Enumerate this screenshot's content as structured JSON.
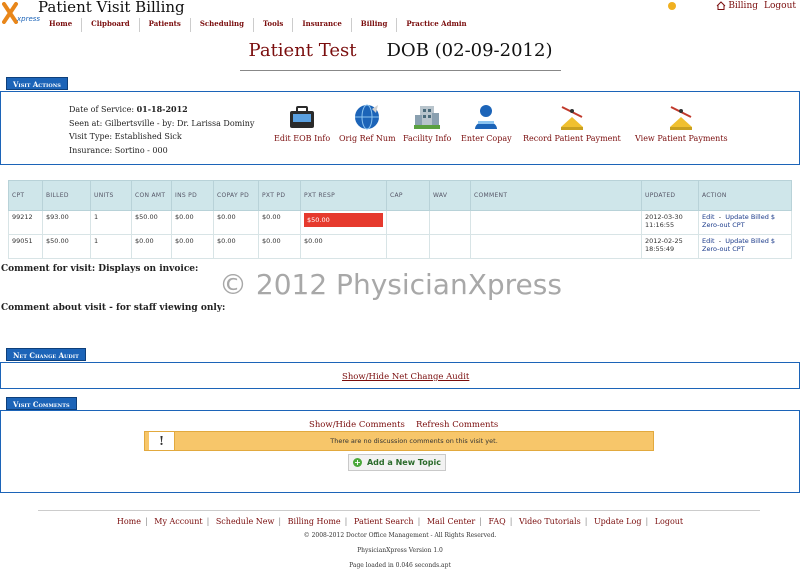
{
  "app": {
    "title": "Patient Visit Billing",
    "logo_text": "xpress"
  },
  "main_nav": [
    "Home",
    "Clipboard",
    "Patients",
    "Scheduling",
    "Tools",
    "Insurance",
    "Billing",
    "Practice Admin"
  ],
  "top_right": {
    "billing_label": "Billing",
    "logout_label": "Logout"
  },
  "patient": {
    "name": "Patient Test",
    "dob": "DOB (02-09-2012)"
  },
  "visit_actions": {
    "section_title": "Visit Actions",
    "info": {
      "date_of_service_label": "Date of Service:",
      "date_of_service": "01-18-2012",
      "seen_at": "Seen at: Gilbertsville - by: Dr. Larissa Dominy",
      "visit_type": "Visit Type: Established Sick",
      "insurance": "Insurance: Sortino - 000"
    },
    "actions": [
      {
        "label": "Edit EOB Info",
        "icon": "briefcase-icon"
      },
      {
        "label": "Orig Ref Num",
        "icon": "globe-icon"
      },
      {
        "label": "Facility Info",
        "icon": "building-icon"
      },
      {
        "label": "Enter Copay",
        "icon": "person-icon"
      },
      {
        "label": "Record Patient Payment",
        "icon": "scale-icon"
      },
      {
        "label": "View Patient Payments",
        "icon": "scale-icon"
      }
    ]
  },
  "charges_table": {
    "columns": [
      "CPT",
      "BILLED",
      "UNITS",
      "CON AMT",
      "INS PD",
      "COPAY PD",
      "PXT PD",
      "PXT RESP",
      "CAP",
      "WAV",
      "COMMENT",
      "UPDATED",
      "ACTION"
    ],
    "rows": [
      {
        "cpt": "99212",
        "billed": "$93.00",
        "units": "1",
        "con_amt": "$50.00",
        "ins_pd": "$0.00",
        "copay_pd": "$0.00",
        "pxt_pd": "$0.00",
        "pxt_resp": "$50.00",
        "cap": "",
        "wav": "",
        "comment": "",
        "updated": "2012-03-30 11:16:55",
        "action_edit": "Edit",
        "action_update": "Update Billed $",
        "action_zero": "Zero-out CPT"
      },
      {
        "cpt": "99051",
        "billed": "$50.00",
        "units": "1",
        "con_amt": "$0.00",
        "ins_pd": "$0.00",
        "copay_pd": "$0.00",
        "pxt_pd": "$0.00",
        "pxt_resp": "$0.00",
        "cap": "",
        "wav": "",
        "comment": "",
        "updated": "2012-02-25 18:55:49",
        "action_edit": "Edit",
        "action_update": "Update Billed $",
        "action_zero": "Zero-out CPT"
      }
    ],
    "highlight_color": "#e63a2e"
  },
  "comments": {
    "invoice_label": "Comment for visit: Displays on invoice:",
    "staff_label": "Comment about visit - for staff viewing only:"
  },
  "watermark": "© 2012 PhysicianXpress",
  "net_change_audit": {
    "section_title": "Net Change Audit",
    "toggle_label": "Show/Hide Net Change Audit"
  },
  "visit_comments": {
    "section_title": "Visit Comments",
    "toggle_label": "Show/Hide Comments",
    "refresh_label": "Refresh Comments",
    "empty_message": "There are no discussion comments on this visit yet.",
    "add_topic_label": "Add a New Topic"
  },
  "footer": {
    "links": [
      "Home",
      "My Account",
      "Schedule New",
      "Billing Home",
      "Patient Search",
      "Mail Center",
      "FAQ",
      "Video Tutorials",
      "Update Log",
      "Logout"
    ],
    "copyright": "© 2008-2012 Doctor Office Management - All Rights Reserved.",
    "version": "PhysicianXpress Version 1.0",
    "load_time": "Page loaded in 0.046 seconds.apt"
  },
  "colors": {
    "brand_red": "#7a0d0d",
    "section_blue": "#1c64b8",
    "table_header": "#cfe6ea",
    "notice_yellow": "#f7c66a"
  }
}
